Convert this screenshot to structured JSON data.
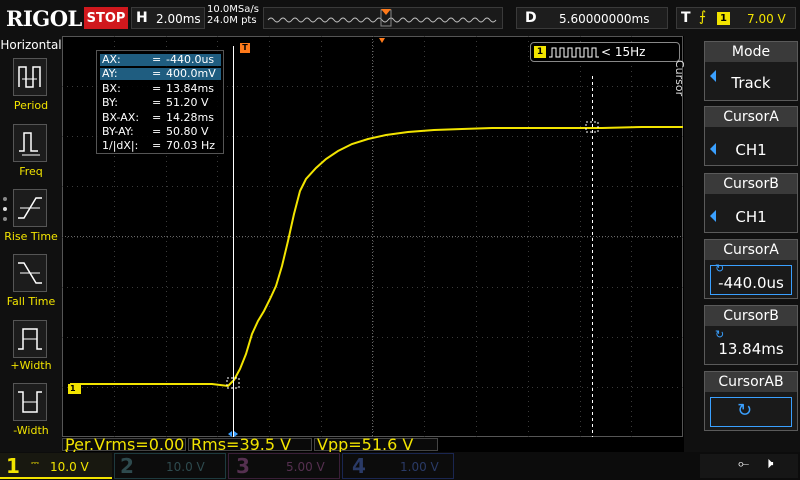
{
  "top": {
    "brand": "RIGOL",
    "run_state": "STOP",
    "horizontal_label": "H",
    "timebase": "2.00ms",
    "sample_rate": "10.0MSa/s",
    "memory_depth": "24.0M pts",
    "delay_label": "D",
    "delay_value": "5.60000000ms",
    "trigger_label": "T",
    "trigger_source": "1",
    "trigger_level": "7.00 V"
  },
  "left_menu": {
    "title": "Horizontal",
    "items": [
      "Period",
      "Freq",
      "Rise Time",
      "Fall Time",
      "+Width",
      "-Width"
    ]
  },
  "right_menu": {
    "title": "Cursor",
    "buttons": [
      {
        "title": "Mode",
        "value": "Track"
      },
      {
        "title": "CursorA",
        "value": "CH1"
      },
      {
        "title": "CursorB",
        "value": "CH1"
      },
      {
        "title": "CursorA",
        "value": "-440.0us"
      },
      {
        "title": "CursorB",
        "value": "13.84ms"
      },
      {
        "title": "CursorAB",
        "value": ""
      }
    ]
  },
  "cursor_panel": {
    "rows": [
      {
        "name": "AX:",
        "eq": "=",
        "value": "-440.0us"
      },
      {
        "name": "AY:",
        "eq": "=",
        "value": "400.0mV"
      },
      {
        "name": "BX:",
        "eq": "=",
        "value": "13.84ms"
      },
      {
        "name": "BY:",
        "eq": "=",
        "value": "51.20 V"
      },
      {
        "name": "BX-AX:",
        "eq": "=",
        "value": "14.28ms"
      },
      {
        "name": "BY-AY:",
        "eq": "=",
        "value": "50.80 V"
      },
      {
        "name": "1/|dX|:",
        "eq": "=",
        "value": "70.03 Hz"
      }
    ]
  },
  "freq_counter": {
    "channel": "1",
    "value": "< 15Hz"
  },
  "measurements": [
    {
      "label": "Per.Vrms=0.00 V"
    },
    {
      "label": "Rms=39.5 V"
    },
    {
      "label": "Vpp=51.6 V"
    }
  ],
  "channels": [
    {
      "num": "1",
      "scale": "10.0 V",
      "color": "#f2e400",
      "active": true
    },
    {
      "num": "2",
      "scale": "10.0 V",
      "color": "#00c8e6",
      "active": false
    },
    {
      "num": "3",
      "scale": "5.00 V",
      "color": "#e040c0",
      "active": false
    },
    {
      "num": "4",
      "scale": "1.00 V",
      "color": "#2060ff",
      "active": false
    }
  ],
  "markers": {
    "ch1_marker": "1",
    "trigger_marker": "T"
  },
  "colors": {
    "ch1": "#f2e400",
    "accent": "#3aa0ff",
    "stop": "#d0181d"
  }
}
